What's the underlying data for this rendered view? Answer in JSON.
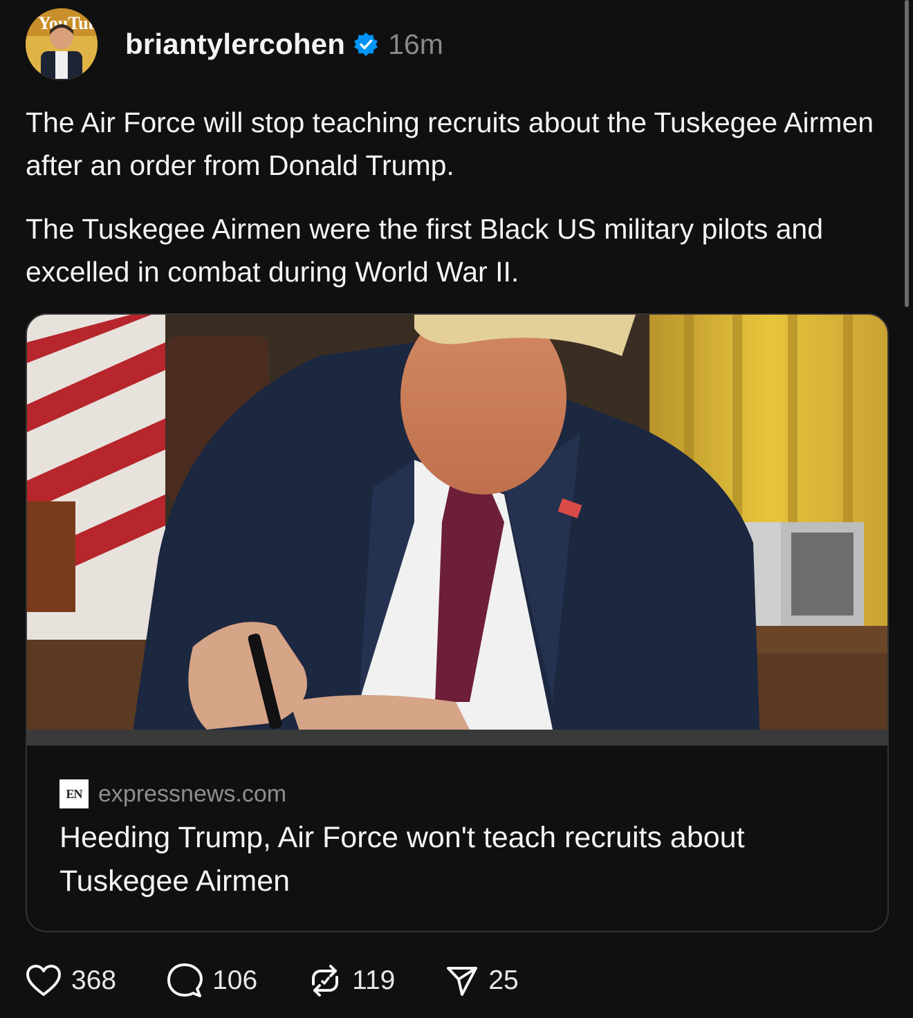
{
  "post": {
    "author": {
      "username": "briantylercohen",
      "verified": true,
      "avatar_caption": "YouTube",
      "time_ago": "16m"
    },
    "paragraphs": [
      "The Air Force will stop teaching recruits about the Tuskegee Airmen after an order from Donald Trump.",
      "The Tuskegee Airmen were the first Black US military pilots and excelled in combat during World War II."
    ],
    "link_card": {
      "favicon_text": "EN",
      "domain": "expressnews.com",
      "title": "Heeding Trump, Air Force won't teach recruits about Tuskegee Airmen"
    },
    "actions": {
      "likes": "368",
      "replies": "106",
      "reposts": "119",
      "shares": "25"
    }
  },
  "icons": {
    "verified": "verified-badge-icon",
    "like": "heart-icon",
    "reply": "comment-bubble-icon",
    "repost": "repost-icon",
    "share": "send-icon"
  },
  "colors": {
    "background": "#101010",
    "text": "#f3f5f7",
    "muted": "#8a8a8a",
    "verified": "#0095f6",
    "card_border": "#333333"
  }
}
